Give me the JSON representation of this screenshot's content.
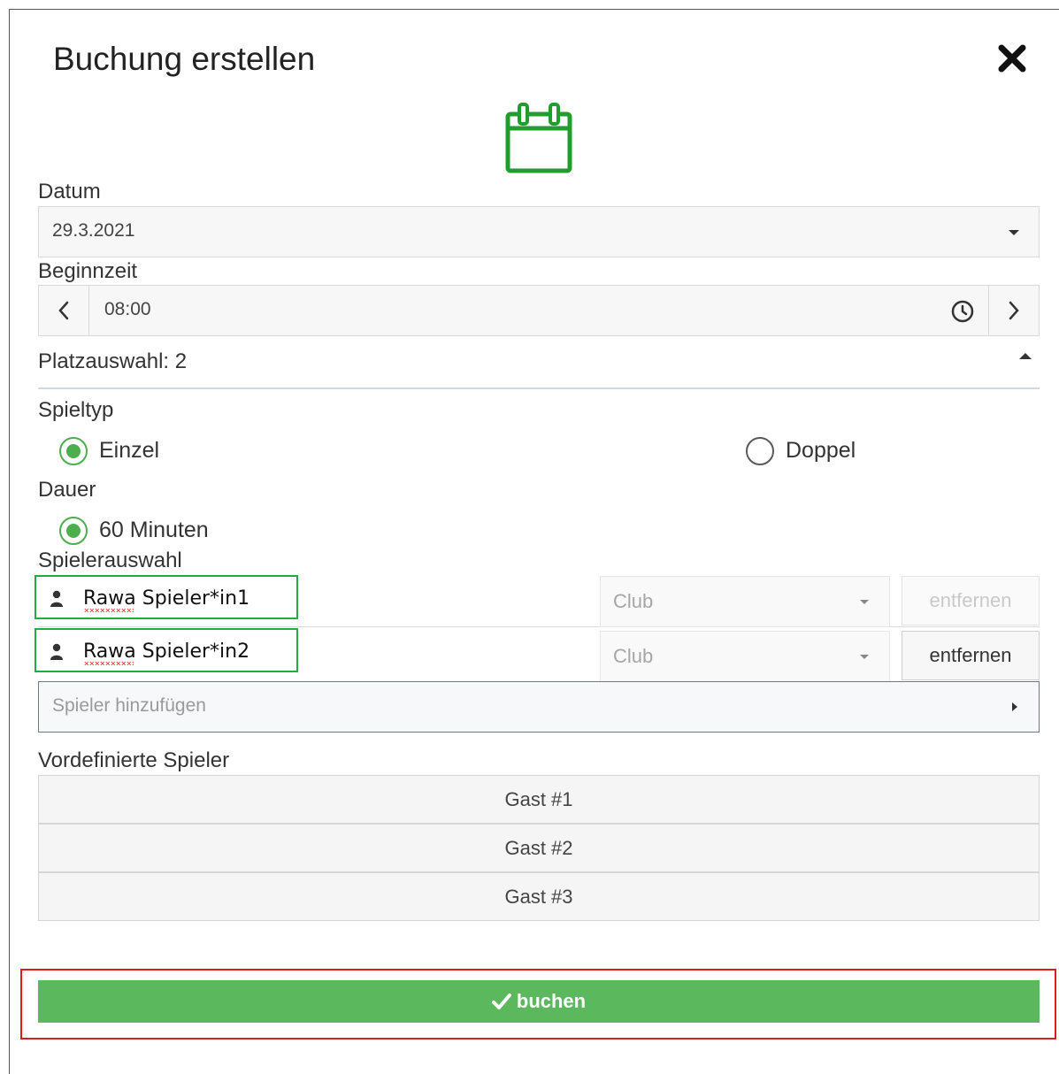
{
  "dialog": {
    "title": "Buchung erstellen",
    "close_icon": "close-icon",
    "header_icon": "calendar-icon"
  },
  "date": {
    "label": "Datum",
    "value": "29.3.2021"
  },
  "start_time": {
    "label": "Beginnzeit",
    "value": "08:00"
  },
  "court_selection": {
    "label": "Platzauswahl: 2"
  },
  "game_type": {
    "label": "Spieltyp",
    "options": [
      {
        "label": "Einzel",
        "selected": true
      },
      {
        "label": "Doppel",
        "selected": false
      }
    ]
  },
  "duration": {
    "label": "Dauer",
    "options": [
      {
        "label": "60 Minuten",
        "selected": true
      }
    ]
  },
  "player_selection": {
    "label": "Spielerauswahl",
    "players": [
      {
        "name": "Rawa Spieler*in1",
        "club_placeholder": "Club",
        "remove_label": "entfernen",
        "remove_enabled": false
      },
      {
        "name": "Rawa Spieler*in2",
        "club_placeholder": "Club",
        "remove_label": "entfernen",
        "remove_enabled": true
      }
    ],
    "add_placeholder": "Spieler hinzufügen"
  },
  "predefined_players": {
    "label": "Vordefinierte Spieler",
    "guests": [
      "Gast #1",
      "Gast #2",
      "Gast #3"
    ]
  },
  "book_button": {
    "label": "buchen",
    "color": "#5cb85c"
  },
  "colors": {
    "accent_green": "#4cae4c",
    "highlight_green": "#28a745",
    "highlight_red": "#e01b1b"
  }
}
